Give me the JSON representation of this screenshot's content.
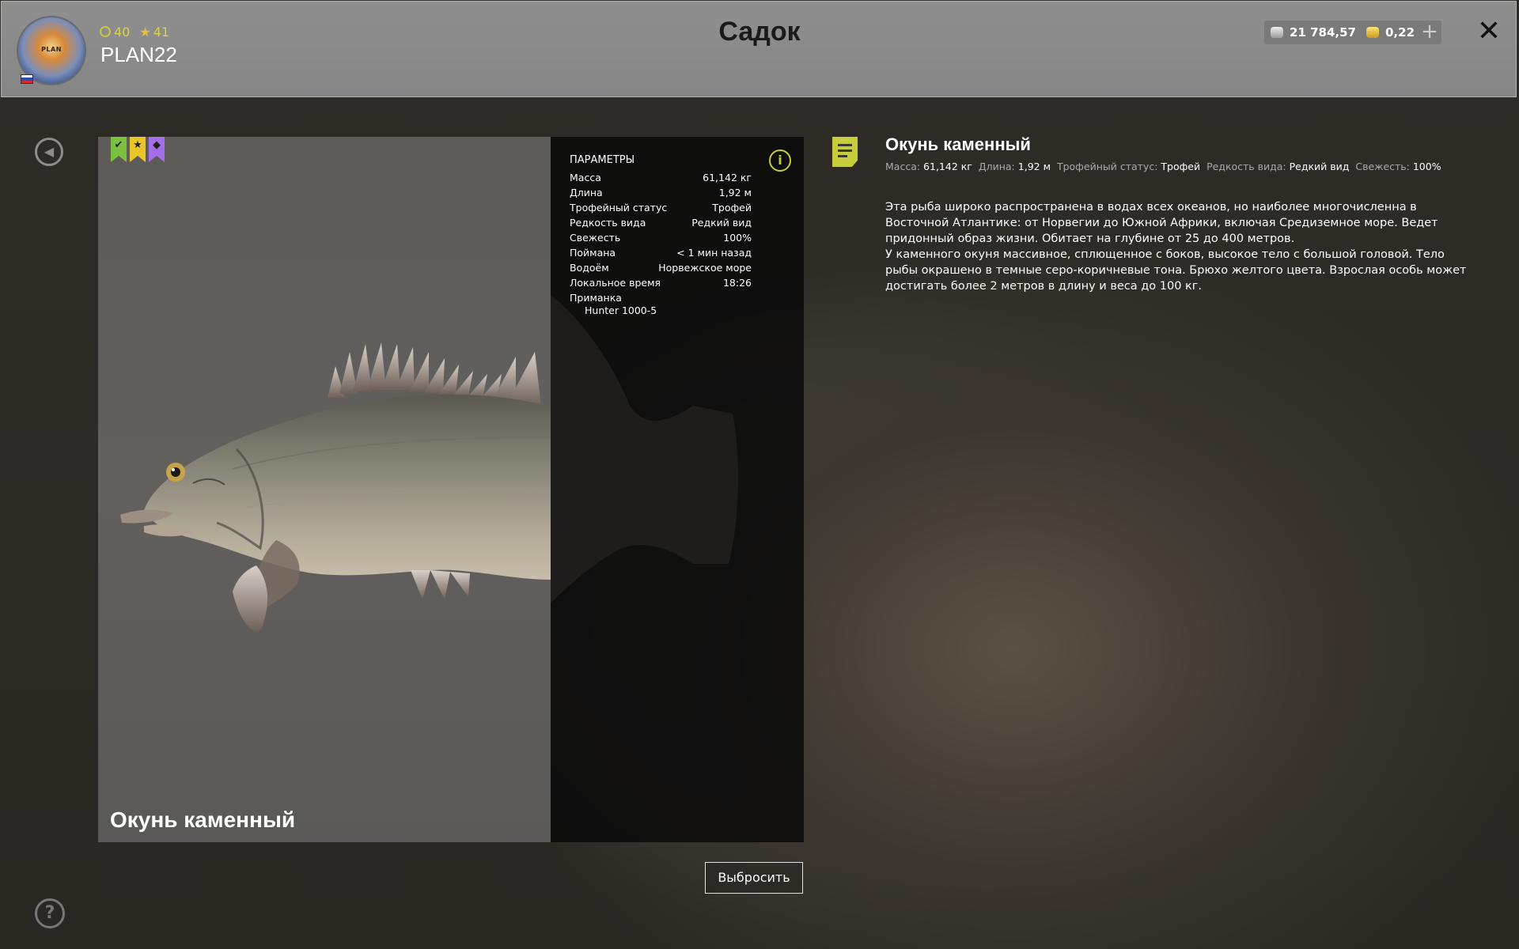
{
  "header": {
    "title": "Садок",
    "username": "PLAN22",
    "avatar_text": "PLAN",
    "level": "40",
    "stars": "41",
    "silver": "21 784,57",
    "gold": "0,22"
  },
  "badges": [
    "✔",
    "★",
    "◆"
  ],
  "fish": {
    "name": "Окунь каменный"
  },
  "params": {
    "title": "ПАРАМЕТРЫ",
    "rows": [
      {
        "label": "Масса",
        "value": "61,142 кг"
      },
      {
        "label": "Длина",
        "value": "1,92 м"
      },
      {
        "label": "Трофейный статус",
        "value": "Трофей"
      },
      {
        "label": "Редкость вида",
        "value": "Редкий вид"
      },
      {
        "label": "Свежесть",
        "value": "100%"
      },
      {
        "label": "Поймана",
        "value": "< 1 мин назад"
      },
      {
        "label": "Водоём",
        "value": "Норвежское море"
      },
      {
        "label": "Локальное время",
        "value": "18:26"
      }
    ],
    "bait_label": "Приманка",
    "bait_value": "Hunter 1000-5"
  },
  "actions": {
    "discard": "Выбросить"
  },
  "description": {
    "title": "Окунь каменный",
    "meta": [
      {
        "label": "Масса:",
        "value": "61,142 кг"
      },
      {
        "label": "Длина:",
        "value": "1,92 м"
      },
      {
        "label": "Трофейный статус:",
        "value": "Трофей"
      },
      {
        "label": "Редкость вида:",
        "value": "Редкий вид"
      },
      {
        "label": "Свежесть:",
        "value": "100%"
      }
    ],
    "paragraph1": "Эта рыба широко распространена в водах всех океанов, но наиболее многочисленна в Восточной Атлантике: от Норвегии до Южной Африки, включая Средиземное море. Ведет придонный образ жизни. Обитает на глубине от 25 до 400 метров.",
    "paragraph2": "У каменного окуня массивное, сплющенное с боков, высокое тело с большой головой. Тело рыбы окрашено в темные серо-коричневые тона. Брюхо желтого цвета. Взрослая особь может достигать более 2 метров в длину и веса до 100 кг."
  },
  "colors": {
    "accent": "#c6cc3a",
    "badge_green": "#7cc13d",
    "badge_yellow": "#e9c52a",
    "badge_purple": "#a46ee6"
  },
  "icons": {
    "back": "back-arrow-icon",
    "help": "help-icon",
    "info": "info-icon",
    "note": "note-icon",
    "close": "close-icon",
    "add": "plus-icon"
  }
}
